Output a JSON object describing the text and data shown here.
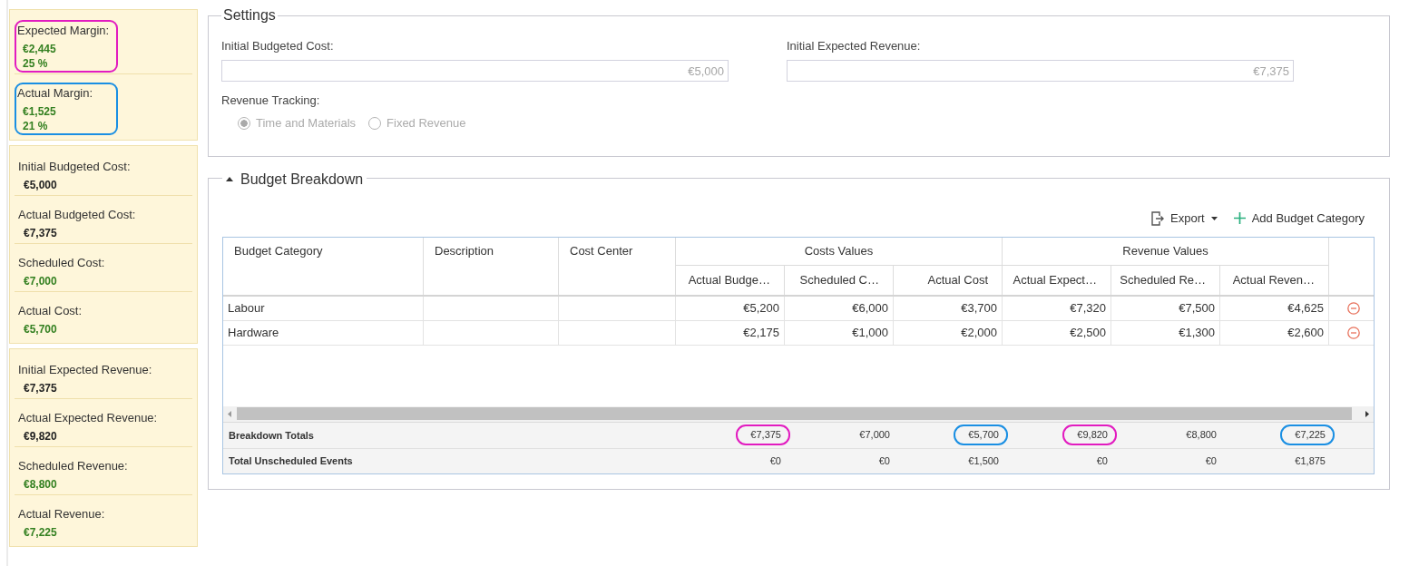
{
  "summary_panels": [
    {
      "items": [
        {
          "label": "Expected Margin:",
          "value": "€2,445",
          "percent": "25 %",
          "color": "#348021",
          "highlight": {
            "color": "#e21cc0"
          }
        },
        {
          "label": "Actual Margin:",
          "value": "€1,525",
          "percent": "21 %",
          "color": "#348021",
          "highlight": {
            "color": "#1a8fe3"
          }
        }
      ]
    },
    {
      "items": [
        {
          "label": "Initial Budgeted Cost:",
          "value": "€5,000",
          "color": "#222222"
        },
        {
          "label": "Actual Budgeted Cost:",
          "value": "€7,375",
          "color": "#222222"
        },
        {
          "label": "Scheduled Cost:",
          "value": "€7,000",
          "color": "#348021"
        },
        {
          "label": "Actual Cost:",
          "value": "€5,700",
          "color": "#348021"
        }
      ]
    },
    {
      "items": [
        {
          "label": "Initial Expected Revenue:",
          "value": "€7,375",
          "color": "#222222"
        },
        {
          "label": "Actual Expected Revenue:",
          "value": "€9,820",
          "color": "#222222"
        },
        {
          "label": "Scheduled Revenue:",
          "value": "€8,800",
          "color": "#348021"
        },
        {
          "label": "Actual Revenue:",
          "value": "€7,225",
          "color": "#348021"
        }
      ]
    }
  ],
  "settings": {
    "title": "Settings",
    "fields": [
      {
        "label": "Initial Budgeted Cost:",
        "value": "€5,000"
      },
      {
        "label": "Initial Expected Revenue:",
        "value": "€7,375"
      }
    ],
    "revenue_tracking": {
      "label": "Revenue Tracking:",
      "disabled": true,
      "options": [
        {
          "label": "Time and Materials",
          "selected": true
        },
        {
          "label": "Fixed Revenue",
          "selected": false
        }
      ]
    }
  },
  "budget_breakdown": {
    "title": "Budget Breakdown",
    "expanded": true,
    "toolbar": [
      {
        "kind": "export",
        "label": "Export"
      },
      {
        "kind": "add",
        "label": "Add Budget Category"
      }
    ],
    "table": {
      "columns": [
        {
          "label": "Budget Category"
        },
        {
          "label": "Description"
        },
        {
          "label": "Cost Center"
        }
      ],
      "groups": [
        {
          "label": "Costs Values",
          "columns": [
            "Actual Budge…",
            "Scheduled C…",
            "Actual Cost"
          ]
        },
        {
          "label": "Revenue Values",
          "columns": [
            "Actual Expect…",
            "Scheduled Re…",
            "Actual Reven…"
          ]
        }
      ],
      "rows": [
        {
          "category": "Labour",
          "values": [
            "€5,200",
            "€6,000",
            "€3,700",
            "€7,320",
            "€7,500",
            "€4,625"
          ]
        },
        {
          "category": "Hardware",
          "values": [
            "€2,175",
            "€1,000",
            "€2,000",
            "€2,500",
            "€1,300",
            "€2,600"
          ]
        }
      ],
      "footer": [
        {
          "label": "Breakdown Totals",
          "values": [
            {
              "text": "€7,375",
              "highlight": {
                "color": "#e21cc0"
              }
            },
            {
              "text": "€7,000"
            },
            {
              "text": "€5,700",
              "highlight": {
                "color": "#1a8fe3"
              }
            },
            {
              "text": "€9,820",
              "highlight": {
                "color": "#e21cc0"
              }
            },
            {
              "text": "€8,800"
            },
            {
              "text": "€7,225",
              "highlight": {
                "color": "#1a8fe3"
              }
            }
          ]
        },
        {
          "label": "Total Unscheduled Events",
          "values": [
            {
              "text": "€0"
            },
            {
              "text": "€0"
            },
            {
              "text": "€1,500"
            },
            {
              "text": "€0"
            },
            {
              "text": "€0"
            },
            {
              "text": "€1,875"
            }
          ]
        }
      ]
    }
  }
}
